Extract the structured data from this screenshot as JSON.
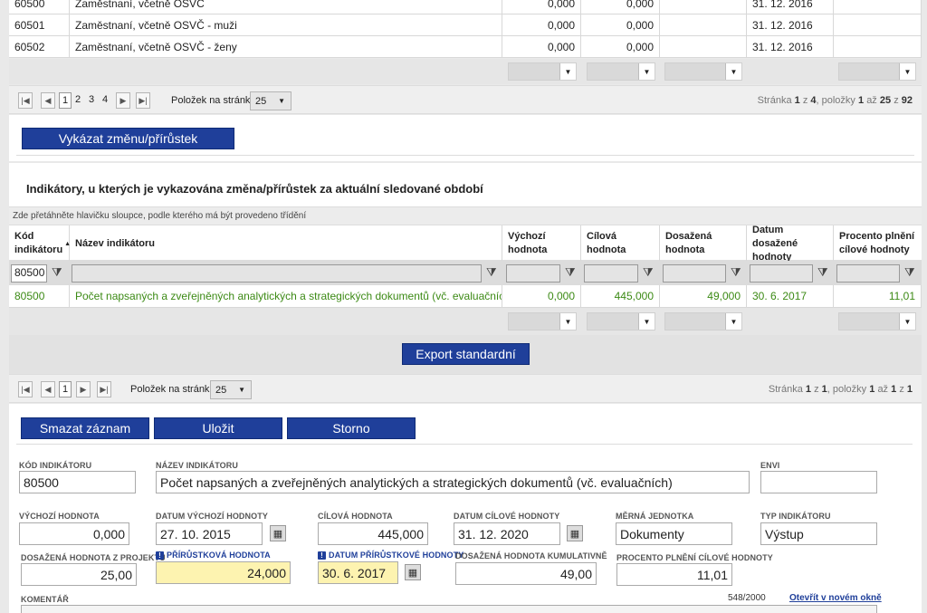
{
  "top_table": {
    "rows": [
      {
        "code": "60500",
        "name": "Zaměstnaní, včetně OSVČ",
        "initial": "0,000",
        "target": "0,000",
        "achieved": "",
        "date": "31. 12. 2016",
        "percent": ""
      },
      {
        "code": "60501",
        "name": "Zaměstnaní, včetně OSVČ - muži",
        "initial": "0,000",
        "target": "0,000",
        "achieved": "",
        "date": "31. 12. 2016",
        "percent": ""
      },
      {
        "code": "60502",
        "name": "Zaměstnaní, včetně OSVČ - ženy",
        "initial": "0,000",
        "target": "0,000",
        "achieved": "",
        "date": "31. 12. 2016",
        "percent": ""
      }
    ],
    "pager": {
      "pages": [
        "1",
        "2",
        "3",
        "4"
      ],
      "current_page": "1",
      "per_page_label": "Položek na stránku",
      "per_page_value": "25",
      "info_prefix": "Stránka",
      "info_page": "1",
      "info_of": "z",
      "info_total_pages": "4",
      "info_items": ", položky",
      "info_from": "1",
      "info_to_word": "až",
      "info_to": "25",
      "info_total": "92"
    },
    "action_button": "Vykázat změnu/přírůstek"
  },
  "changed_section": {
    "title": "Indikátory, u kterých je vykazována změna/přírůstek za aktuální sledované období",
    "group_hint": "Zde přetáhněte hlavičku sloupce, podle kterého má být provedeno třídění",
    "columns": {
      "code": "Kód indikátoru",
      "name": "Název indikátoru",
      "initial": "Výchozí hodnota",
      "target": "Cílová hodnota",
      "achieved": "Dosažená hodnota",
      "date": "Datum dosažené hodnoty",
      "percent": "Procento plnění cílové hodnoty"
    },
    "filter_code_value": "80500",
    "row": {
      "code": "80500",
      "name": "Počet napsaných a zveřejněných analytických a strategických dokumentů (vč. evaluačních)",
      "initial": "0,000",
      "target": "445,000",
      "achieved": "49,000",
      "date": "30. 6. 2017",
      "percent": "11,01"
    },
    "export_button": "Export standardní",
    "pager": {
      "current_page": "1",
      "per_page_label": "Položek na stránku",
      "per_page_value": "25",
      "info_prefix": "Stránka",
      "info_page": "1",
      "info_of": "z",
      "info_total_pages": "1",
      "info_items": ", položky",
      "info_from": "1",
      "info_to_word": "až",
      "info_to": "1",
      "info_total": "1"
    }
  },
  "form": {
    "buttons": {
      "delete": "Smazat záznam",
      "save": "Uložit",
      "cancel": "Storno"
    },
    "labels": {
      "code": "Kód indikátoru",
      "name": "Název indikátoru",
      "envi": "ENVI",
      "initial": "Výchozí hodnota",
      "initial_date": "Datum výchozí hodnoty",
      "target": "Cílová hodnota",
      "target_date": "Datum cílové hodnoty",
      "unit": "Měrná jednotka",
      "type": "Typ indikátoru",
      "achieved_project": "Dosažená hodnota z projektu",
      "increment": "Přírůstková hodnota",
      "increment_date": "Datum přírůstkové hodnoty",
      "achieved_cumulative": "Dosažená hodnota kumulativně",
      "percent": "Procento plnění cílové hodnoty",
      "comment": "Komentář"
    },
    "values": {
      "code": "80500",
      "name": "Počet napsaných a zveřejněných analytických a strategických dokumentů (vč. evaluačních)",
      "envi": "",
      "initial": "0,000",
      "initial_date": "27. 10. 2015",
      "target": "445,000",
      "target_date": "31. 12. 2020",
      "unit": "Dokumenty",
      "type": "Výstup",
      "achieved_project": "25,00",
      "increment": "24,000",
      "increment_date": "30. 6. 2017",
      "achieved_cumulative": "49,00",
      "percent": "11,01"
    },
    "comment_counter": "548/2000",
    "open_new_window": "Otevřít v novém okně"
  },
  "colors": {
    "button_blue": "#1f3f9a",
    "green_row": "#3c8a15",
    "required_yellow": "#fdf3b0"
  }
}
